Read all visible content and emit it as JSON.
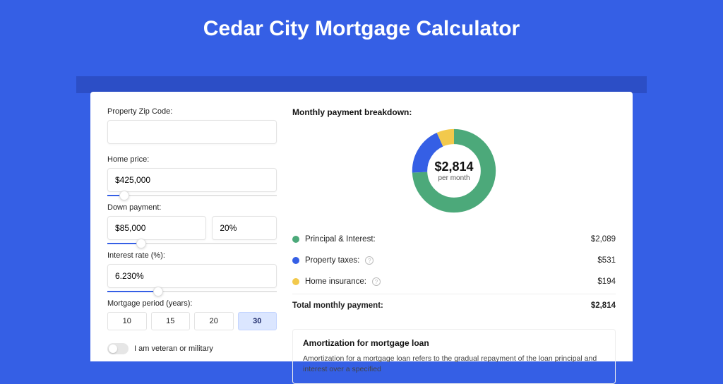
{
  "page_title": "Cedar City Mortgage Calculator",
  "form": {
    "zip": {
      "label": "Property Zip Code:",
      "value": ""
    },
    "home_price": {
      "label": "Home price:",
      "value": "$425,000",
      "slider_pct": 10
    },
    "down_payment": {
      "label": "Down payment:",
      "amount_value": "$85,000",
      "percent_value": "20%",
      "slider_pct": 20
    },
    "interest_rate": {
      "label": "Interest rate (%):",
      "value": "6.230%",
      "slider_pct": 30
    },
    "mortgage_period": {
      "label": "Mortgage period (years):",
      "options": [
        "10",
        "15",
        "20",
        "30"
      ],
      "selected": "30"
    },
    "veteran": {
      "label": "I am veteran or military",
      "checked": false
    }
  },
  "breakdown": {
    "title": "Monthly payment breakdown:",
    "center_amount": "$2,814",
    "center_label": "per month",
    "items": [
      {
        "label": "Principal & Interest:",
        "value": "$2,089",
        "info": false,
        "swatch": "sw-green"
      },
      {
        "label": "Property taxes:",
        "value": "$531",
        "info": true,
        "swatch": "sw-blue"
      },
      {
        "label": "Home insurance:",
        "value": "$194",
        "info": true,
        "swatch": "sw-yellow"
      }
    ],
    "total_label": "Total monthly payment:",
    "total_value": "$2,814"
  },
  "chart_data": {
    "type": "pie",
    "title": "Monthly payment breakdown:",
    "series": [
      {
        "name": "Principal & Interest",
        "value": 2089,
        "color": "#4ca97a"
      },
      {
        "name": "Property taxes",
        "value": 531,
        "color": "#355fe5"
      },
      {
        "name": "Home insurance",
        "value": 194,
        "color": "#f2c94c"
      }
    ],
    "center_amount": "$2,814",
    "center_label": "per month"
  },
  "amortization": {
    "title": "Amortization for mortgage loan",
    "text": "Amortization for a mortgage loan refers to the gradual repayment of the loan principal and interest over a specified"
  }
}
